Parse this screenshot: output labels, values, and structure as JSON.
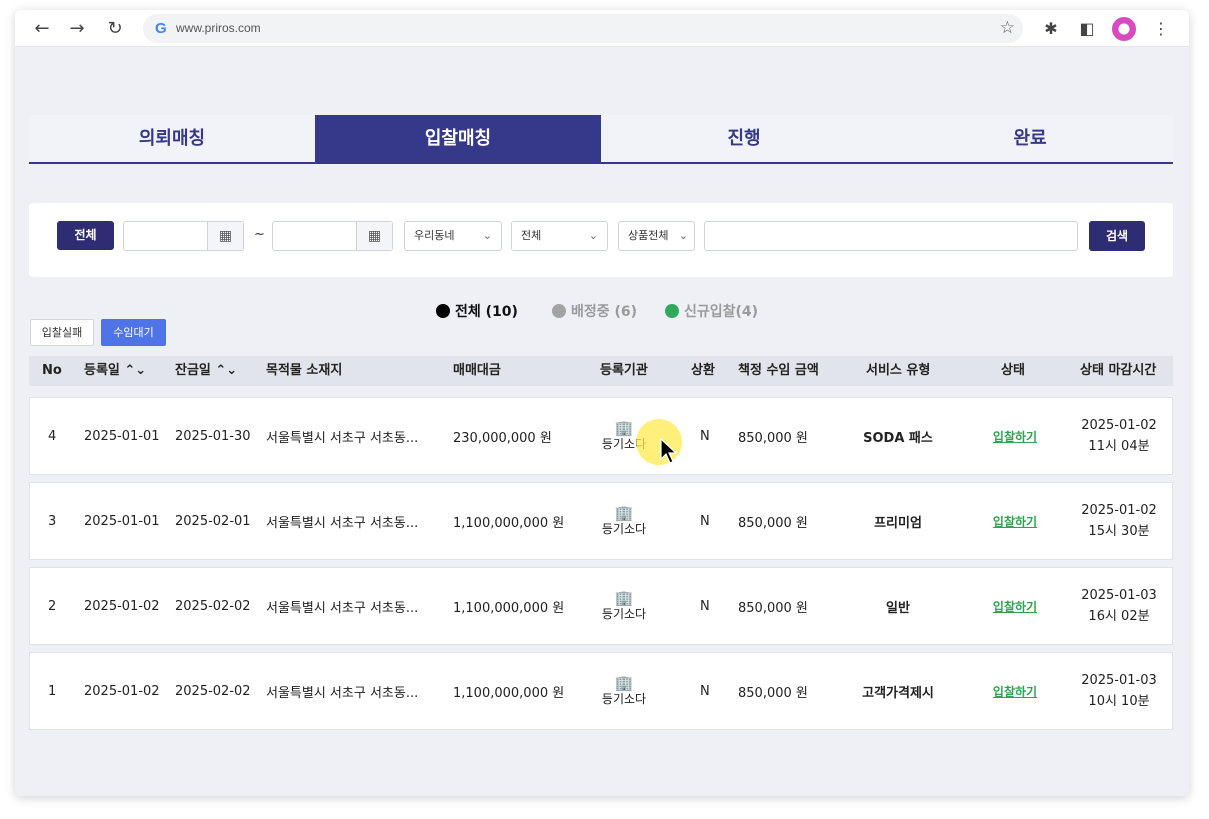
{
  "browser": {
    "url": "www.priros.com",
    "back_icon": "arrow-left-icon",
    "forward_icon": "arrow-right-icon",
    "reload_icon": "reload-icon"
  },
  "tabs": [
    {
      "label": "의뢰매칭",
      "active": false
    },
    {
      "label": "입찰매칭",
      "active": true
    },
    {
      "label": "진행",
      "active": false
    },
    {
      "label": "완료",
      "active": false
    }
  ],
  "filter": {
    "all_button": "전체",
    "tilde": "~",
    "region_select": "우리동네",
    "type_select": "전체",
    "product_select": "상품전체",
    "search_value": "",
    "search_button": "검색"
  },
  "legend": [
    {
      "label": "전체 (10)",
      "color": "#000000",
      "text_color": "#111111"
    },
    {
      "label": "배정중 (6)",
      "color": "#a3a3a3",
      "text_color": "#9a9a9a"
    },
    {
      "label": "신규입찰(4)",
      "color": "#2eaa5a",
      "text_color": "#9a9a9a"
    }
  ],
  "sub_buttons": {
    "fail": "입찰실패",
    "waiting": "수임대기"
  },
  "table": {
    "headers": {
      "no": "No",
      "reg_date": "등록일 ⌃⌄",
      "balance_date": "잔금일 ⌃⌄",
      "location": "목적물 소재지",
      "price": "매매대금",
      "agency": "등록기관",
      "repay": "상환",
      "fee": "책정 수임 금액",
      "service": "서비스 유형",
      "status": "상태",
      "deadline": "상태 마감시간"
    },
    "rows": [
      {
        "no": "4",
        "reg_date": "2025-01-01",
        "balance_date": "2025-01-30",
        "location": "서울특별시 서초구 서초동...",
        "price": "230,000,000 원",
        "agency": "등기소다",
        "repay": "N",
        "fee": "850,000 원",
        "service": "SODA 패스",
        "status": "입찰하기",
        "deadline_date": "2025-01-02",
        "deadline_time": "11시 04분"
      },
      {
        "no": "3",
        "reg_date": "2025-01-01",
        "balance_date": "2025-02-01",
        "location": "서울특별시 서초구 서초동...",
        "price": "1,100,000,000 원",
        "agency": "등기소다",
        "repay": "N",
        "fee": "850,000 원",
        "service": "프리미엄",
        "status": "입찰하기",
        "deadline_date": "2025-01-02",
        "deadline_time": "15시 30분"
      },
      {
        "no": "2",
        "reg_date": "2025-01-02",
        "balance_date": "2025-02-02",
        "location": "서울특별시 서초구 서초동...",
        "price": "1,100,000,000 원",
        "agency": "등기소다",
        "repay": "N",
        "fee": "850,000 원",
        "service": "일반",
        "status": "입찰하기",
        "deadline_date": "2025-01-03",
        "deadline_time": "16시 02분"
      },
      {
        "no": "1",
        "reg_date": "2025-01-02",
        "balance_date": "2025-02-02",
        "location": "서울특별시 서초구 서초동...",
        "price": "1,100,000,000 원",
        "agency": "등기소다",
        "repay": "N",
        "fee": "850,000 원",
        "service": "고객가격제시",
        "status": "입찰하기",
        "deadline_date": "2025-01-03",
        "deadline_time": "10시 10분"
      }
    ]
  }
}
